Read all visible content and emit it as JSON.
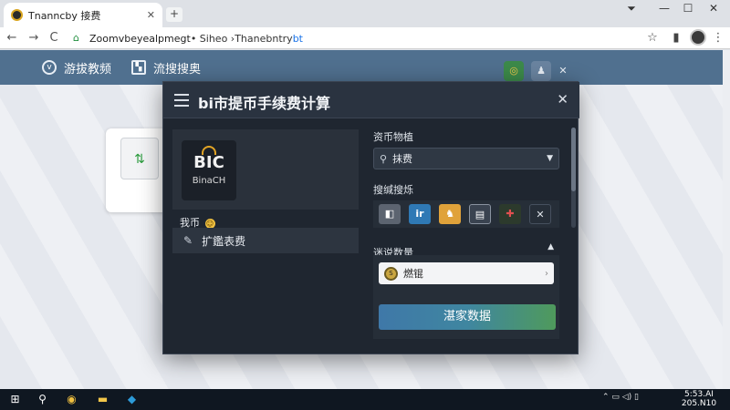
{
  "browser": {
    "tab_title": "Tnanncby 接费",
    "tab_close": "✕",
    "new_tab": "+",
    "window_controls": {
      "minimize": "—",
      "maximize": "☐",
      "close": "✕",
      "extra": "⏷"
    },
    "nav": {
      "back": "←",
      "forward": "→",
      "reload": "C"
    },
    "address": {
      "main": "Zoomvbeyealpmegt",
      "middle": " • Siheo › ",
      "rest": "Thanebntry",
      "highlight": "bt"
    },
    "toolbar": {
      "bookmark": "☆",
      "extension": "▮",
      "menu": "⋮"
    },
    "colors": {
      "accent": "#1a73e8",
      "tab_bg": "#dee1e6"
    }
  },
  "site": {
    "nav": [
      {
        "icon": "v",
        "label": "游拔教频"
      },
      {
        "icon": "▚",
        "label": "流搜搜奥"
      }
    ],
    "header_close": "✕",
    "header_color": "#50708f"
  },
  "modal": {
    "title": "bi市提币手续费计算",
    "close": "✕",
    "logo": {
      "mark": "BIC",
      "sub": "BinaCH"
    },
    "my_coin_label": "我币",
    "my_coin_emoji": "☺",
    "ext_row_label": "扩鑑表费",
    "asset_label": "资币物植",
    "asset_select_value": "抹费",
    "network_label": "搜缄搜烁",
    "network_icons": [
      {
        "name": "tag",
        "glyph": "◧",
        "color": "#5c6470"
      },
      {
        "name": "tumblr",
        "glyph": "ir",
        "color": "#2f79b5"
      },
      {
        "name": "twitter",
        "glyph": "♞",
        "color": "#e0a23a"
      },
      {
        "name": "doc",
        "glyph": "▤",
        "color": "#3a4350"
      },
      {
        "name": "chart",
        "glyph": "✚",
        "color": "#2c3a2c"
      }
    ],
    "network_clear": "✕",
    "quantity_label": "迷说数量",
    "quantity_value": "燃锟",
    "quantity_badge": "S",
    "submit_label": "湛家数据",
    "colors": {
      "bg": "#1f2630",
      "button_start": "#3f78a8",
      "button_end": "#4f9a5c"
    }
  },
  "taskbar": {
    "start": "⊞",
    "search": "⚲",
    "apps": [
      "◉",
      "▬",
      "◆"
    ],
    "tray": "⌃ ▭ ◁) ▯",
    "time": "5:53.AI",
    "date": "205.N10"
  }
}
